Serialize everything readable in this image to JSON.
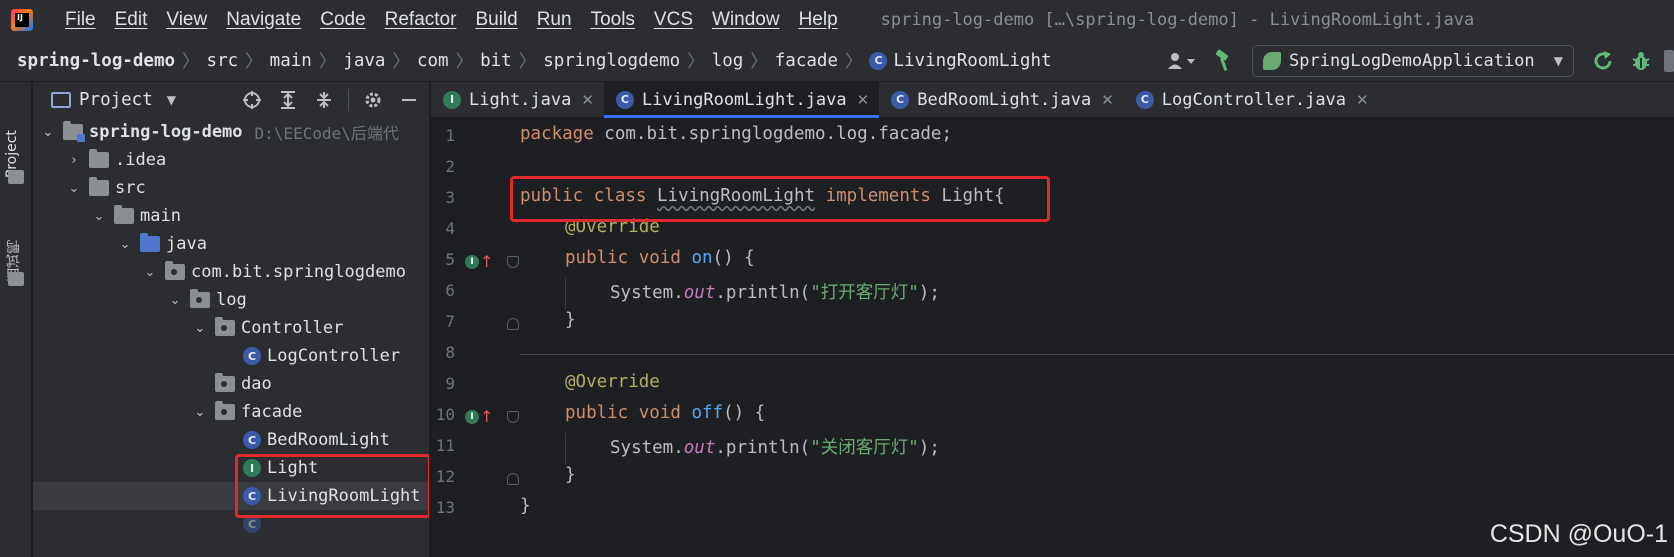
{
  "menubar": {
    "items": [
      "File",
      "Edit",
      "View",
      "Navigate",
      "Code",
      "Refactor",
      "Build",
      "Run",
      "Tools",
      "VCS",
      "Window",
      "Help"
    ],
    "window_title": "spring-log-demo […\\spring-log-demo] - LivingRoomLight.java"
  },
  "breadcrumbs": [
    "spring-log-demo",
    "src",
    "main",
    "java",
    "com",
    "bit",
    "springlogdemo",
    "log",
    "facade",
    "LivingRoomLight"
  ],
  "toolbar": {
    "run_config": "SpringLogDemoApplication",
    "icons": [
      "user-icon",
      "hammer-icon",
      "rerun-icon",
      "debug-icon"
    ]
  },
  "tool_stripe": {
    "project_label": "Project",
    "interview_label": "面试鸭"
  },
  "project_panel": {
    "title": "Project",
    "tree": [
      {
        "label": "spring-log-demo",
        "path": "D:\\EECode\\后端代",
        "kind": "module",
        "expanded": true,
        "depth": 0
      },
      {
        "label": ".idea",
        "kind": "folder",
        "expanded": false,
        "depth": 1
      },
      {
        "label": "src",
        "kind": "folder",
        "expanded": true,
        "depth": 1
      },
      {
        "label": "main",
        "kind": "folder",
        "expanded": true,
        "depth": 2
      },
      {
        "label": "java",
        "kind": "source-root",
        "expanded": true,
        "depth": 3
      },
      {
        "label": "com.bit.springlogdemo",
        "kind": "package",
        "expanded": true,
        "depth": 4
      },
      {
        "label": "log",
        "kind": "package",
        "expanded": true,
        "depth": 5
      },
      {
        "label": "Controller",
        "kind": "package",
        "expanded": true,
        "depth": 6
      },
      {
        "label": "LogController",
        "kind": "class",
        "depth": 7
      },
      {
        "label": "dao",
        "kind": "package",
        "expanded": false,
        "depth": 6
      },
      {
        "label": "facade",
        "kind": "package",
        "expanded": true,
        "depth": 6
      },
      {
        "label": "BedRoomLight",
        "kind": "class",
        "depth": 7
      },
      {
        "label": "Light",
        "kind": "interface",
        "depth": 7
      },
      {
        "label": "LivingRoomLight",
        "kind": "class",
        "depth": 7,
        "selected": true
      }
    ]
  },
  "editor": {
    "tabs": [
      {
        "label": "Light.java",
        "kind": "interface",
        "active": false
      },
      {
        "label": "LivingRoomLight.java",
        "kind": "class",
        "active": true
      },
      {
        "label": "BedRoomLight.java",
        "kind": "class",
        "active": false
      },
      {
        "label": "LogController.java",
        "kind": "class",
        "active": false
      }
    ],
    "line_numbers": [
      "1",
      "2",
      "3",
      "4",
      "5",
      "6",
      "7",
      "8",
      "9",
      "10",
      "11",
      "12",
      "13"
    ],
    "code": {
      "l1_kw": "package",
      "l1_rest": " com.bit.springlogdemo.log.facade;",
      "l3_kw1": "public",
      "l3_kw2": "class",
      "l3_cls": "LivingRoomLight",
      "l3_kw3": "implements",
      "l3_rest": " Light{",
      "l4_ann": "@Override",
      "l5_kw1": "public",
      "l5_kw2": "void",
      "l5_fn": "on",
      "l5_rest": "() {",
      "l6_a": "System.",
      "l6_out": "out",
      "l6_b": ".println(",
      "l6_str": "\"打开客厅灯\"",
      "l6_c": ");",
      "l7": "}",
      "l9_ann": "@Override",
      "l10_kw1": "public",
      "l10_kw2": "void",
      "l10_fn": "off",
      "l10_rest": "() {",
      "l11_a": "System.",
      "l11_out": "out",
      "l11_b": ".println(",
      "l11_str": "\"关闭客厅灯\"",
      "l11_c": ");",
      "l12": "}",
      "l13": "}"
    }
  },
  "watermark": "CSDN @OuO-1",
  "colors": {
    "highlight_box": "#e0292f",
    "keyword": "#cf8e6d",
    "annotation": "#b3ae60",
    "string": "#6aab73",
    "method": "#56a8f5",
    "static_field": "#c77dbb",
    "active_tab_underline": "#3574f0"
  }
}
